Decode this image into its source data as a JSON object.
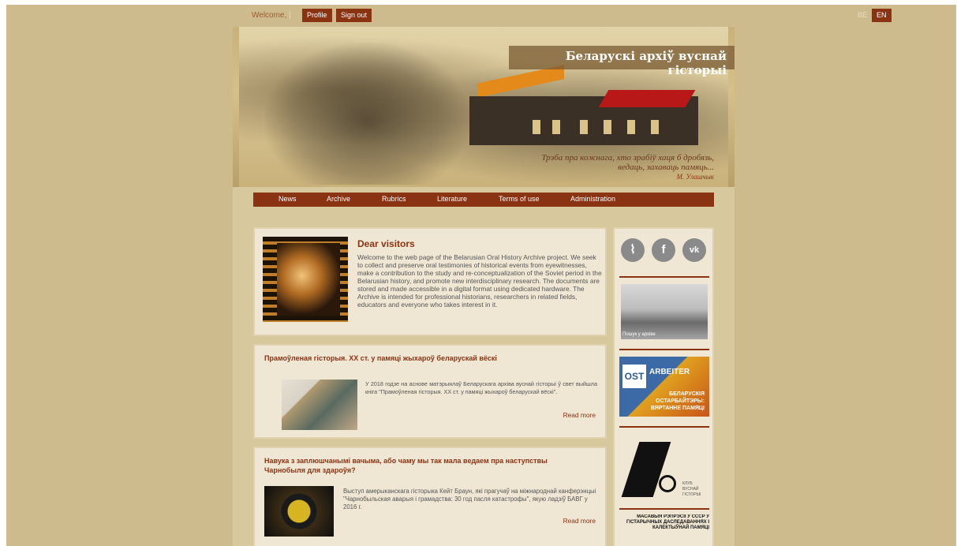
{
  "topbar": {
    "welcome": "Welcome,",
    "separator": "|",
    "profile": "Profile",
    "sign_out": "Sign out",
    "lang_be": "BE",
    "lang_en": "EN"
  },
  "header": {
    "banner_title": "Беларускі архіў вуснай гісторыі",
    "quote_line1": "Трэба пра кожнага, хто зрабіў хаця б дробязь,",
    "quote_line2": "ведаць, захаваць памяць...",
    "quote_author": "М. Улашчык"
  },
  "nav": {
    "items": [
      "News",
      "Archive",
      "Rubrics",
      "Literature",
      "Terms of use",
      "Administration"
    ]
  },
  "welcome_card": {
    "title": "Dear visitors",
    "body": "Welcome to the web page of the Belarusian Oral History Archive project. We seek to collect and preserve oral testimonies of historical events from eyewitnesses, make a contribution to the study and re-conceptualization of the Soviet period in the Belarusian history, and promote new interdisciplinary research. The documents are stored and made accessible in a digital format using dedicated hardware. The Archive is intended for professional historians, researchers in related fields, educators and everyone who takes interest in it."
  },
  "posts": [
    {
      "title": "Прамоўленая гісторыя. ХХ ст. у памяці жыхароў беларускай вёскі",
      "text": "У 2018 годзе на аснове матэрыялаў Беларускага архіва вуснай гісторыі ў свет выйшла кніга \"Прамоўленая гісторыя. ХХ ст. у памяці жыхароў беларускай вёскі\".",
      "read_more": "Read more"
    },
    {
      "title": "Навука з заплюшчанымі вачыма, або чаму мы так мала ведаем пра наступствы Чарнобыля для здароўя?",
      "text": "Выступ амерыканскага гісторыка Кейт Браун, які прагучаў на міжнароднай канферэнцыі \"Чарнобыльская аварыя і грамадства: 30 год пасля катастрофы\", якую ладзіў БАВГ у 2016 г.",
      "read_more": "Read more"
    }
  ],
  "sidebar": {
    "social": [
      "rss-icon",
      "facebook-icon",
      "vk-icon"
    ],
    "social_glyphs": [
      "⌇",
      "f",
      "vk"
    ],
    "photo_label": "Пошук у архіве",
    "ost_logo": "OST",
    "ost_brand": "ARBEITER",
    "ost_text": "БЕЛАРУСКІЯ ОСТАРБАЙТЭРЫ: ВЯРТАННЕ ПАМЯЦІ",
    "logo_caption": "КЛУБ ВУСНАЙ ГІСТОРЫІ",
    "repr_text": "МАСАВЫЯ РЭПРЭСІІ Ў СССР У ГІСТАРЫЧНЫХ ДАСЛЕДАВАННЯХ І КАЛЕКТЫЎНАЙ ПАМЯЦІ"
  }
}
